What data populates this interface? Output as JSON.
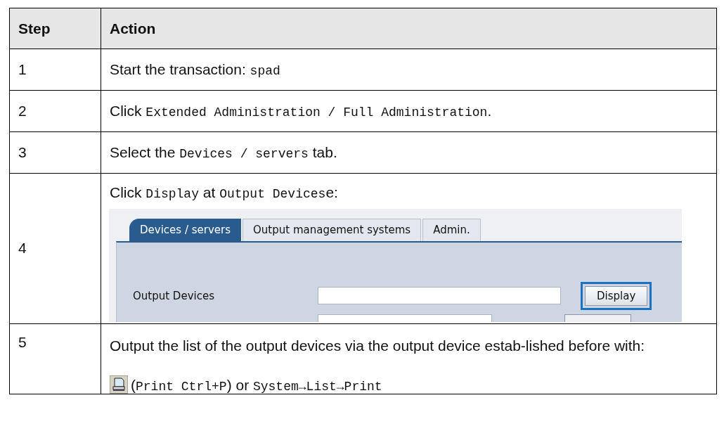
{
  "table": {
    "columns": [
      "Step",
      "Action"
    ],
    "rows": [
      {
        "step": "1",
        "action": [
          {
            "kind": "plain",
            "text": "Start the transaction: "
          },
          {
            "kind": "code",
            "text": "spad"
          }
        ]
      },
      {
        "step": "2",
        "action": [
          {
            "kind": "plain",
            "text": "Click "
          },
          {
            "kind": "code",
            "text": "Extended Administration / Full Administration"
          },
          {
            "kind": "plain",
            "text": "."
          }
        ]
      },
      {
        "step": "3",
        "action": [
          {
            "kind": "plain",
            "text": "Select the "
          },
          {
            "kind": "code",
            "text": "Devices / servers"
          },
          {
            "kind": "plain",
            "text": " tab."
          }
        ]
      },
      {
        "step": "4",
        "action": [
          {
            "kind": "plain",
            "text": "Click "
          },
          {
            "kind": "code",
            "text": "Display"
          },
          {
            "kind": "plain",
            "text": " at "
          },
          {
            "kind": "code",
            "text": "Output Devices"
          },
          {
            "kind": "plain",
            "text": "e:"
          }
        ],
        "extra": {
          "kind": "screenshot",
          "tabs": [
            {
              "label": "Devices / servers",
              "selected": true
            },
            {
              "label": "Output management systems",
              "selected": false
            },
            {
              "label": "Admin.",
              "selected": false
            }
          ],
          "fields": [
            {
              "label": "Output Devices",
              "button": "Display",
              "focused": true
            }
          ]
        }
      },
      {
        "step": "5",
        "action": [
          {
            "kind": "plain",
            "text": "Output the list of the output devices via the output device estab-lished before with:"
          }
        ],
        "extra": {
          "kind": "command",
          "parts": [
            {
              "kind": "plain",
              "text": "("
            },
            {
              "kind": "code",
              "text": "Print Ctrl+P"
            },
            {
              "kind": "plain",
              "text": ") or "
            },
            {
              "kind": "code",
              "text": "System→List→Print"
            }
          ]
        }
      }
    ]
  }
}
